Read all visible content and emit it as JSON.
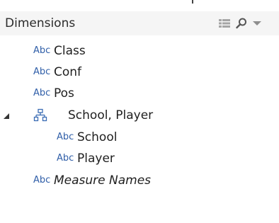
{
  "header": {
    "title": "Dimensions"
  },
  "icons": {
    "grid": "list-view-icon",
    "search": "search-icon",
    "menu": "chevron-down-icon",
    "type": "string-type-icon",
    "hierarchy": "hierarchy-icon",
    "expand": "collapse-triangle-icon"
  },
  "type_badge": "Abc",
  "colors": {
    "badge": "#2f5ea8",
    "header_bg": "#f5f5f5",
    "icon_gray": "#9a9a9a"
  },
  "fields": [
    {
      "label": "Class"
    },
    {
      "label": "Conf"
    },
    {
      "label": "Pos"
    }
  ],
  "hierarchy": {
    "label": "School, Player",
    "children": [
      {
        "label": "School"
      },
      {
        "label": "Player"
      }
    ]
  },
  "measure_names": {
    "label": "Measure Names"
  }
}
